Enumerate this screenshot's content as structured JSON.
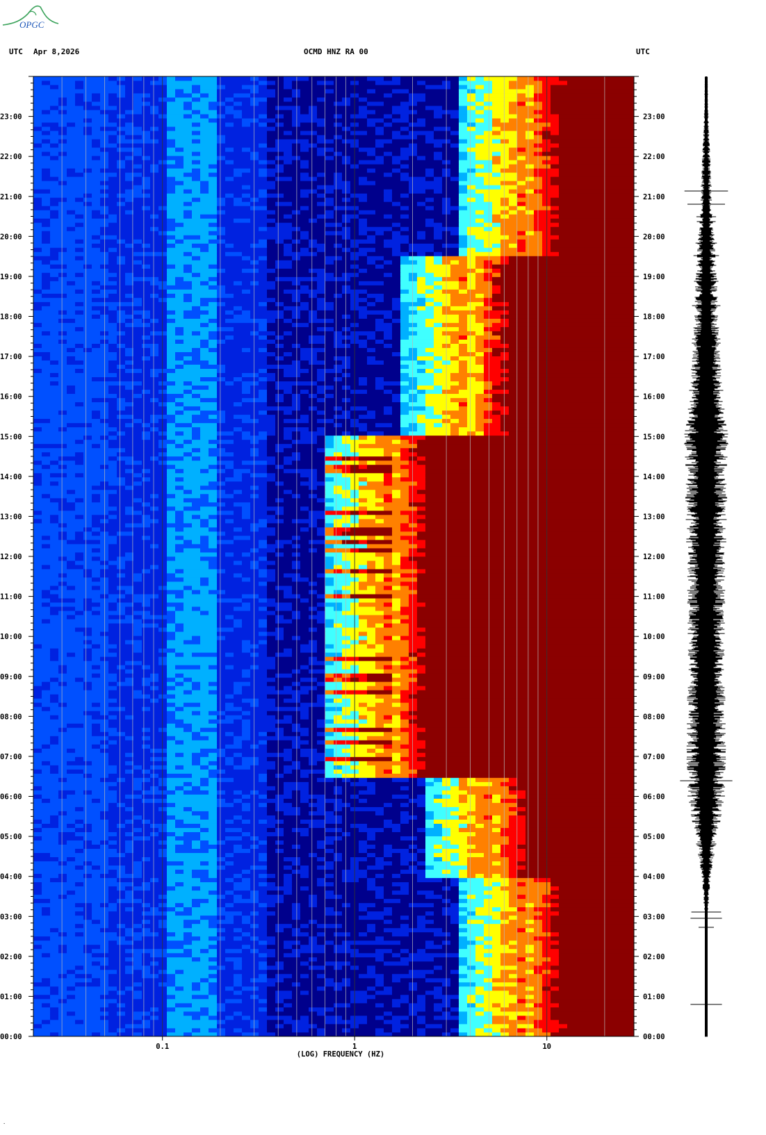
{
  "logo_text": "OPGC",
  "header": {
    "left_tz": "UTC",
    "date": "Apr 8,2026",
    "station": "OCMD HNZ RA 00",
    "right_tz": "UTC"
  },
  "colors": {
    "colormap": [
      "#00008c",
      "#0022e0",
      "#0050ff",
      "#00b0ff",
      "#40ffff",
      "#ffff00",
      "#ff8000",
      "#ff0000",
      "#8b0000"
    ],
    "grid_line": "#b8b8b8",
    "trace": "#000000"
  },
  "footer_mark": "·",
  "chart_data": [
    {
      "type": "heatmap",
      "title": "",
      "xlabel": "(LOG) FREQUENCY (HZ)",
      "ylabel": "",
      "x_scale": "log",
      "x_range_hz": [
        0.0213,
        28.4
      ],
      "x_tick_labels": [
        {
          "value": 0.1,
          "label": "0.1"
        },
        {
          "value": 1,
          "label": "1"
        },
        {
          "value": 10,
          "label": "10"
        }
      ],
      "y_range_utc": [
        "00:00",
        "24:00"
      ],
      "y_tick_labels": [
        "00:00",
        "01:00",
        "02:00",
        "03:00",
        "04:00",
        "05:00",
        "06:00",
        "07:00",
        "08:00",
        "09:00",
        "10:00",
        "11:00",
        "12:00",
        "13:00",
        "14:00",
        "15:00",
        "16:00",
        "17:00",
        "18:00",
        "19:00",
        "20:00",
        "21:00",
        "22:00",
        "23:00"
      ],
      "grid": true,
      "description_zones": [
        {
          "utc_start": "00:00",
          "utc_end": "04:00",
          "high_energy_min_hz": 7.5
        },
        {
          "utc_start": "04:00",
          "utc_end": "06:30",
          "high_energy_min_hz": 5.0
        },
        {
          "utc_start": "06:30",
          "utc_end": "15:00",
          "high_energy_min_hz": 1.5
        },
        {
          "utc_start": "15:00",
          "utc_end": "19:30",
          "high_energy_min_hz": 4.0
        },
        {
          "utc_start": "19:30",
          "utc_end": "24:00",
          "high_energy_min_hz": 7.5
        }
      ]
    },
    {
      "type": "line",
      "title": "",
      "y_range_utc": [
        "00:00",
        "24:00"
      ],
      "amplitude_profile": [
        {
          "utc": "00:00",
          "level": 0.05
        },
        {
          "utc": "03:00",
          "level": 0.06
        },
        {
          "utc": "04:00",
          "level": 0.2
        },
        {
          "utc": "05:00",
          "level": 0.5
        },
        {
          "utc": "06:00",
          "level": 0.8
        },
        {
          "utc": "07:00",
          "level": 0.85
        },
        {
          "utc": "10:00",
          "level": 0.8
        },
        {
          "utc": "14:00",
          "level": 0.9
        },
        {
          "utc": "15:00",
          "level": 0.95
        },
        {
          "utc": "17:00",
          "level": 0.6
        },
        {
          "utc": "19:00",
          "level": 0.45
        },
        {
          "utc": "21:00",
          "level": 0.25
        },
        {
          "utc": "23:00",
          "level": 0.1
        },
        {
          "utc": "24:00",
          "level": 0.06
        }
      ]
    }
  ]
}
